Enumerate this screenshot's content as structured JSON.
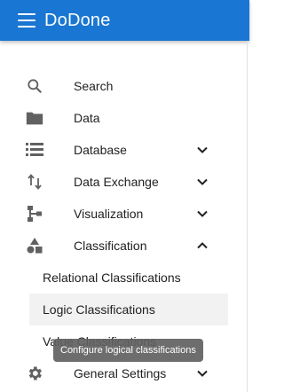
{
  "app": {
    "title": "DoDone"
  },
  "colors": {
    "appbar": "#1976d2",
    "icon": "#616161",
    "active_bg": "#f2f2f2",
    "tooltip_bg": "#616161"
  },
  "nav": {
    "search": {
      "label": "Search",
      "icon": "search-icon"
    },
    "data": {
      "label": "Data",
      "icon": "folder-icon"
    },
    "database": {
      "label": "Database",
      "icon": "list-icon",
      "expanded": false
    },
    "data_exchange": {
      "label": "Data Exchange",
      "icon": "swap-vertical-icon",
      "expanded": false
    },
    "visualization": {
      "label": "Visualization",
      "icon": "hierarchy-icon",
      "expanded": false
    },
    "classification": {
      "label": "Classification",
      "icon": "shapes-icon",
      "expanded": true,
      "children": [
        {
          "label": "Relational Classifications"
        },
        {
          "label": "Logic Classifications",
          "active": true
        },
        {
          "label": "Value Classifications"
        }
      ]
    },
    "general_settings": {
      "label": "General Settings",
      "icon": "gear-icon",
      "expanded": false
    }
  },
  "tooltip": {
    "text": "Configure logical classifications"
  }
}
